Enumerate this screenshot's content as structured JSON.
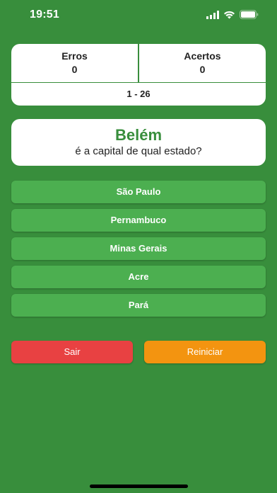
{
  "status": {
    "time": "19:51"
  },
  "score": {
    "errors_label": "Erros",
    "errors_value": "0",
    "correct_label": "Acertos",
    "correct_value": "0",
    "progress": "1 - 26"
  },
  "question": {
    "city": "Belém",
    "text": "é a capital de qual estado?"
  },
  "options": [
    "São Paulo",
    "Pernambuco",
    "Minas Gerais",
    "Acre",
    "Pará"
  ],
  "actions": {
    "exit_label": "Sair",
    "restart_label": "Reiniciar"
  },
  "colors": {
    "background": "#388e3c",
    "option": "#4caf50",
    "exit": "#e84142",
    "restart": "#f39410"
  }
}
